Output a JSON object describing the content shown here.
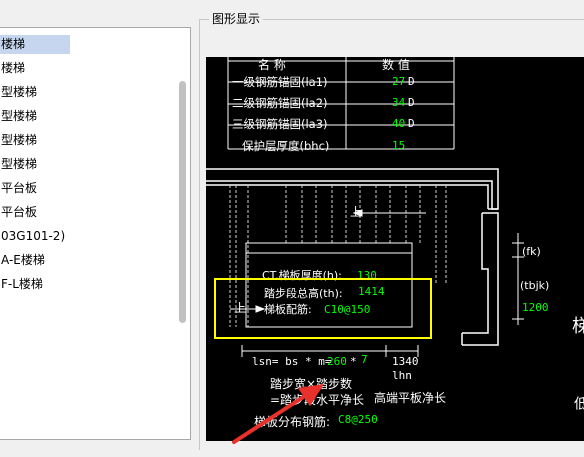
{
  "tree": {
    "items": [
      {
        "label": "楼梯",
        "selected": true
      },
      {
        "label": "楼梯"
      },
      {
        "label": "型楼梯"
      },
      {
        "label": "型楼梯"
      },
      {
        "label": "型楼梯"
      },
      {
        "label": "型楼梯"
      },
      {
        "label": "平台板"
      },
      {
        "label": "平台板"
      },
      {
        "label": "03G101-2)"
      },
      {
        "label": "A-E楼梯"
      },
      {
        "label": "F-L楼梯"
      }
    ]
  },
  "group": {
    "title": "图形显示"
  },
  "drawing": {
    "table": {
      "header_name": "名 称",
      "header_value": "数 值",
      "rows": [
        {
          "name": "一级钢筋锚固(la1)",
          "value": "27",
          "unit": "D"
        },
        {
          "name": "二级钢筋锚固(la2)",
          "value": "34",
          "unit": "D"
        },
        {
          "name": "三级钢筋锚固(la3)",
          "value": "40",
          "unit": "D"
        },
        {
          "name": "保护层厚度(bhc)",
          "value": "15",
          "unit": ""
        }
      ]
    },
    "up_label_top": "上",
    "up_label_bottom": "上",
    "slab_thickness_label": "CT.梯板厚度(h):",
    "slab_thickness_value": "130",
    "step_height_label": "踏步段总高(th):",
    "step_height_value": "1414",
    "slab_rebar_label": "梯板配筋:",
    "slab_rebar_value": "C10@150",
    "fk_label": "(fk)",
    "tbjk_label": "(tbjk)",
    "tbjk_value": "1200",
    "lsn_label": "lsn= bs * m=",
    "lsn_value1": "260",
    "lsn_star": "*",
    "lsn_value2": "7",
    "lsn_result": "1340",
    "lhn_label": "lhn",
    "step_width_label": "踏步宽×踏步数",
    "horizontal_length_label": "=踏步段水平净长",
    "high_end_label": "高端平板净长",
    "dist_rebar_label": "梯板分布钢筋:",
    "dist_rebar_value": "C8@250",
    "edge_text_1": "梯",
    "edge_text_2": "低"
  },
  "colors": {
    "canvas_bg": "#000000",
    "line": "#ffffff",
    "value_green": "#00ff00",
    "highlight_box": "#ffff00",
    "arrow_red": "#e8312a",
    "selection": "#c6d6ee"
  }
}
